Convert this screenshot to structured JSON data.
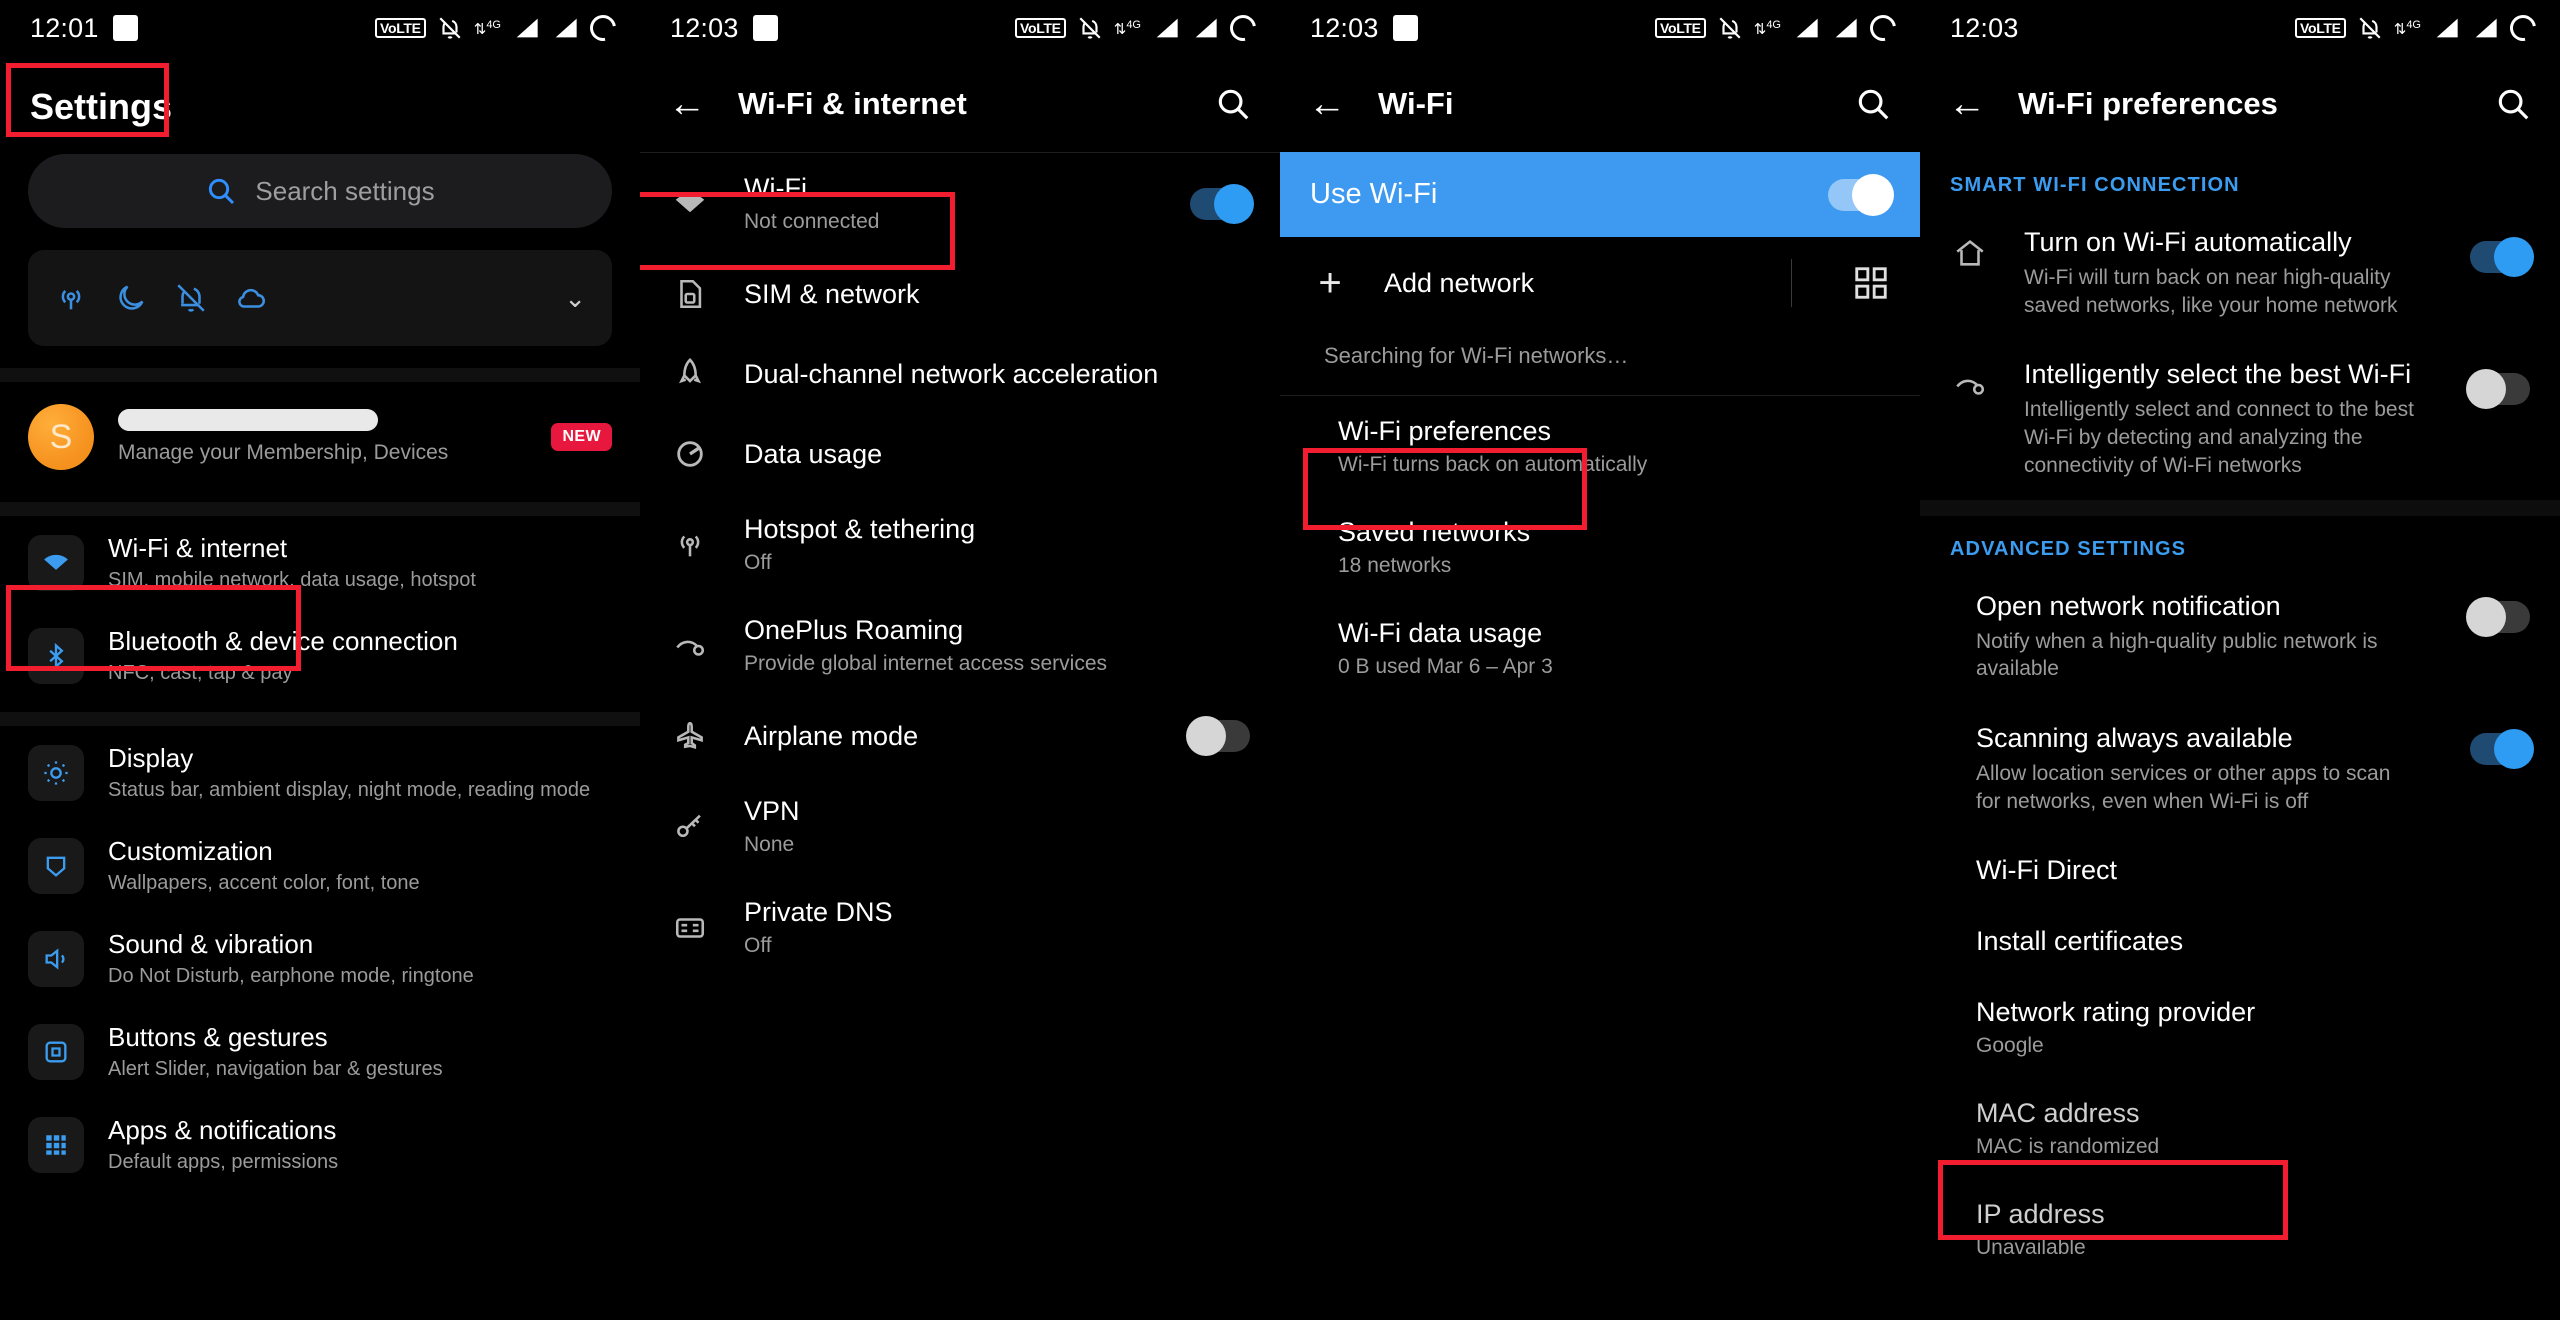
{
  "panels": [
    {
      "status": {
        "time": "12:01",
        "volte": "VoLTE"
      },
      "title": "Settings",
      "search_placeholder": "Search settings",
      "quick_icons": [
        "location-icon",
        "moon-icon",
        "bell-mute-icon",
        "cloud-icon"
      ],
      "account": {
        "name_redacted": true,
        "subtitle": "Manage your Membership, Devices",
        "badge": "NEW",
        "initial": "S"
      },
      "items": [
        {
          "title": "Wi-Fi & internet",
          "subtitle": "SIM, mobile network, data usage, hotspot",
          "icon": "wifi-icon"
        },
        {
          "title": "Bluetooth & device connection",
          "subtitle": "NFC, cast, tap & pay",
          "icon": "bluetooth-icon"
        },
        {
          "title": "Display",
          "subtitle": "Status bar, ambient display, night mode, reading mode",
          "icon": "brightness-icon"
        },
        {
          "title": "Customization",
          "subtitle": "Wallpapers, accent color, font, tone",
          "icon": "palette-icon"
        },
        {
          "title": "Sound & vibration",
          "subtitle": "Do Not Disturb, earphone mode, ringtone",
          "icon": "volume-icon"
        },
        {
          "title": "Buttons & gestures",
          "subtitle": "Alert Slider, navigation bar & gestures",
          "icon": "gestures-icon"
        },
        {
          "title": "Apps & notifications",
          "subtitle": "Default apps, permissions",
          "icon": "apps-icon"
        }
      ]
    },
    {
      "status": {
        "time": "12:03",
        "volte": "VoLTE"
      },
      "title": "Wi-Fi & internet",
      "search_icon": "search-icon",
      "back_icon": "back-arrow-icon",
      "items": [
        {
          "title": "Wi-Fi",
          "subtitle": "Not connected",
          "icon": "wifi-icon",
          "toggle": "on"
        },
        {
          "title": "SIM & network",
          "subtitle": "",
          "icon": "sim-card-icon"
        },
        {
          "title": "Dual-channel network acceleration",
          "subtitle": "",
          "icon": "rocket-icon"
        },
        {
          "title": "Data usage",
          "subtitle": "",
          "icon": "data-usage-icon"
        },
        {
          "title": "Hotspot & tethering",
          "subtitle": "Off",
          "icon": "hotspot-icon"
        },
        {
          "title": "OnePlus Roaming",
          "subtitle": "Provide global internet access services",
          "icon": "roaming-icon"
        },
        {
          "title": "Airplane mode",
          "subtitle": "",
          "icon": "airplane-icon",
          "toggle": "off"
        },
        {
          "title": "VPN",
          "subtitle": "None",
          "icon": "vpn-key-icon"
        },
        {
          "title": "Private DNS",
          "subtitle": "Off",
          "icon": "dns-icon"
        }
      ]
    },
    {
      "status": {
        "time": "12:03",
        "volte": "VoLTE"
      },
      "title": "Wi-Fi",
      "use_wifi_label": "Use Wi-Fi",
      "use_wifi_state": "on",
      "add_network_label": "Add network",
      "qr_icon": "qr-scan-icon",
      "searching_text": "Searching for Wi-Fi networks…",
      "items": [
        {
          "title": "Wi-Fi preferences",
          "subtitle": "Wi-Fi turns back on automatically"
        },
        {
          "title": "Saved networks",
          "subtitle": "18 networks"
        },
        {
          "title": "Wi-Fi data usage",
          "subtitle": "0 B used Mar 6 – Apr 3"
        }
      ]
    },
    {
      "status": {
        "time": "12:03",
        "volte": "VoLTE"
      },
      "title": "Wi-Fi preferences",
      "groups": [
        {
          "header": "SMART WI-FI CONNECTION",
          "items": [
            {
              "title": "Turn on Wi-Fi automatically",
              "subtitle": "Wi-Fi will turn back on near high-quality saved networks, like your home network",
              "icon": "home-icon",
              "toggle": "on"
            },
            {
              "title": "Intelligently select the best Wi-Fi",
              "subtitle": "Intelligently select and connect to the best Wi-Fi by detecting and analyzing the connectivity of Wi-Fi networks",
              "icon": "roaming-icon",
              "toggle": "off"
            }
          ]
        },
        {
          "header": "ADVANCED SETTINGS",
          "items": [
            {
              "title": "Open network notification",
              "subtitle": "Notify when a high-quality public network is available",
              "toggle": "off"
            },
            {
              "title": "Scanning always available",
              "subtitle": "Allow location services or other apps to scan for networks, even when Wi-Fi is off",
              "toggle": "on"
            },
            {
              "title": "Wi-Fi Direct",
              "subtitle": ""
            },
            {
              "title": "Install certificates",
              "subtitle": ""
            },
            {
              "title": "Network rating provider",
              "subtitle": "Google"
            },
            {
              "title": "MAC address",
              "subtitle": "MAC is randomized"
            },
            {
              "title": "IP address",
              "subtitle": "Unavailable"
            }
          ]
        }
      ]
    }
  ],
  "annotations": {
    "accent": "#f21d2f",
    "boxes": [
      "settings-title",
      "wifi-internet-row",
      "wifi-row",
      "wifi-preferences-row",
      "mac-address-row"
    ]
  }
}
